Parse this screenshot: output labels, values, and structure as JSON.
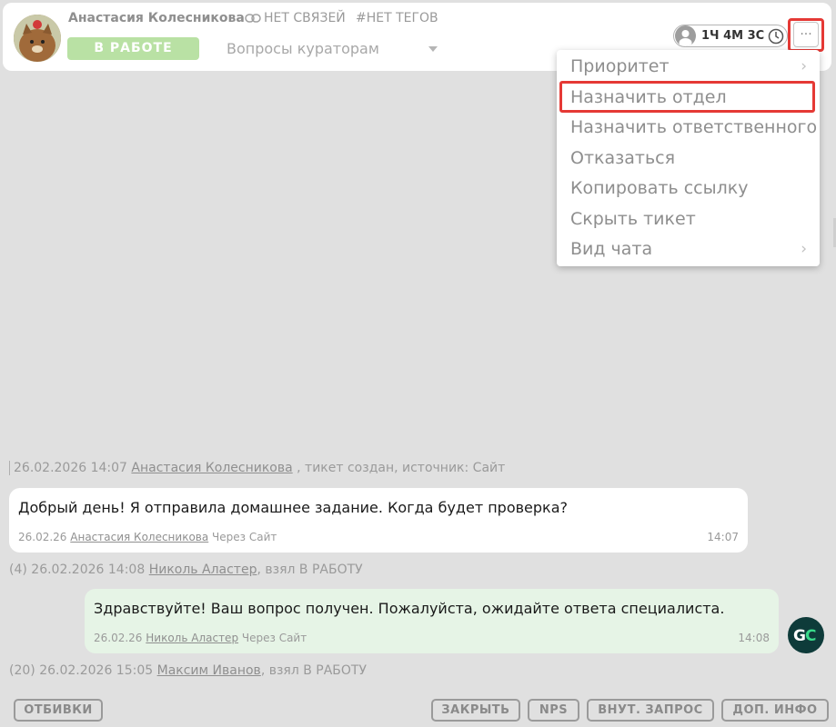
{
  "header": {
    "client_name": "Анастасия Колесникова",
    "links_label": "НЕТ СВЯЗЕЙ",
    "tags_label": "#НЕТ ТЕГОВ",
    "status": "В РАБОТЕ",
    "category": "Вопросы кураторам",
    "timer": "1Ч 4М 3С",
    "more_label": "···",
    "colors": {
      "status_bg": "#b9e1a4",
      "highlight": "#e53935"
    }
  },
  "menu": {
    "items": [
      {
        "label": "Приоритет",
        "chevron": "›"
      },
      {
        "label": "Назначить отдел"
      },
      {
        "label": "Назначить ответственного"
      },
      {
        "label": "Отказаться"
      },
      {
        "label": "Копировать ссылку"
      },
      {
        "label": "Скрыть тикет"
      },
      {
        "label": "Вид чата",
        "chevron": "›"
      }
    ]
  },
  "chat": {
    "created_event": {
      "datetime": "26.02.2026 14:07",
      "author": "Анастасия Колесникова",
      "suffix": ", тикет создан, источник: Сайт"
    },
    "message1": {
      "text": "Добрый день! Я отправила домашнее задание. Когда будет проверка?",
      "date": "26.02.26",
      "author": "Анастасия Колесникова",
      "source": "Через Сайт",
      "time": "14:07"
    },
    "event2": {
      "prefix": "(4) 26.02.2026 14:08",
      "author": "Николь Аластер",
      "suffix": ", взял В РАБОТУ"
    },
    "message2": {
      "text": "Здравствуйте! Ваш вопрос получен. Пожалуйста, ожидайте ответа специалиста.",
      "date": "26.02.26",
      "author": "Николь Аластер",
      "source": "Через Сайт",
      "time": "14:08",
      "avatar_text": "GC"
    },
    "event3": {
      "prefix": "(20) 26.02.2026 15:05",
      "author": "Максим Иванов",
      "suffix": ", взял В РАБОТУ"
    }
  },
  "footer": {
    "templates": "ОТБИВКИ",
    "close": "ЗАКРЫТЬ",
    "nps": "NPS",
    "internal": "ВНУТ. ЗАПРОС",
    "info": "ДОП. ИНФО"
  }
}
